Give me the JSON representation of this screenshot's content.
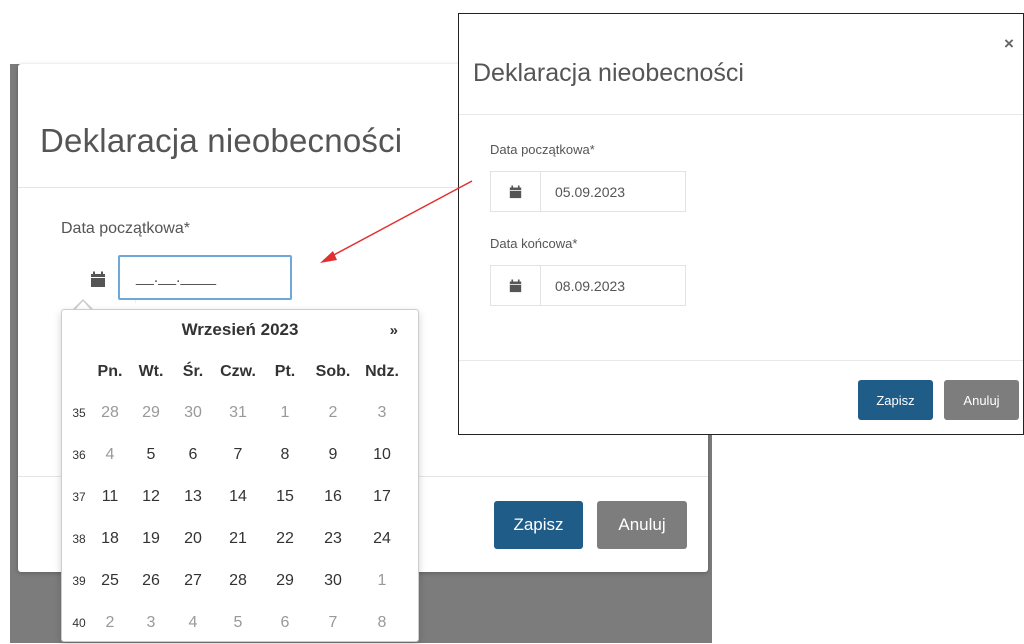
{
  "background_modal": {
    "title": "Deklaracja nieobecności",
    "start_date_label": "Data początkowa*",
    "start_date_value": "__.__.____",
    "save_label": "Zapisz",
    "cancel_label": "Anuluj",
    "icons": {
      "addon": "calendar-icon"
    }
  },
  "calendar": {
    "month_label": "Wrzesień 2023",
    "next_label": "»",
    "weekdays": [
      "Pn.",
      "Wt.",
      "Śr.",
      "Czw.",
      "Pt.",
      "Sob.",
      "Ndz."
    ],
    "weeks": [
      {
        "week": "35",
        "days": [
          "28",
          "29",
          "30",
          "31",
          "1",
          "2",
          "3"
        ],
        "muted": [
          true,
          true,
          true,
          true,
          true,
          true,
          true
        ]
      },
      {
        "week": "36",
        "days": [
          "4",
          "5",
          "6",
          "7",
          "8",
          "9",
          "10"
        ],
        "muted": [
          true,
          false,
          false,
          false,
          false,
          false,
          false
        ]
      },
      {
        "week": "37",
        "days": [
          "11",
          "12",
          "13",
          "14",
          "15",
          "16",
          "17"
        ],
        "muted": [
          false,
          false,
          false,
          false,
          false,
          false,
          false
        ]
      },
      {
        "week": "38",
        "days": [
          "18",
          "19",
          "20",
          "21",
          "22",
          "23",
          "24"
        ],
        "muted": [
          false,
          false,
          false,
          false,
          false,
          false,
          false
        ]
      },
      {
        "week": "39",
        "days": [
          "25",
          "26",
          "27",
          "28",
          "29",
          "30",
          "1"
        ],
        "muted": [
          false,
          false,
          false,
          false,
          false,
          false,
          true
        ]
      },
      {
        "week": "40",
        "days": [
          "2",
          "3",
          "4",
          "5",
          "6",
          "7",
          "8"
        ],
        "muted": [
          true,
          true,
          true,
          true,
          true,
          true,
          true
        ]
      }
    ]
  },
  "inset_modal": {
    "title": "Deklaracja nieobecności",
    "close_label": "×",
    "start_date_label": "Data początkowa*",
    "start_date_value": "05.09.2023",
    "end_date_label": "Data końcowa*",
    "end_date_value": "08.09.2023",
    "save_label": "Zapisz",
    "cancel_label": "Anuluj"
  },
  "colors": {
    "primary_button": "#1f5c88",
    "secondary_button": "#7d7d7d",
    "annotation_arrow": "#e03030",
    "input_focus_border": "#6ea8d8"
  }
}
